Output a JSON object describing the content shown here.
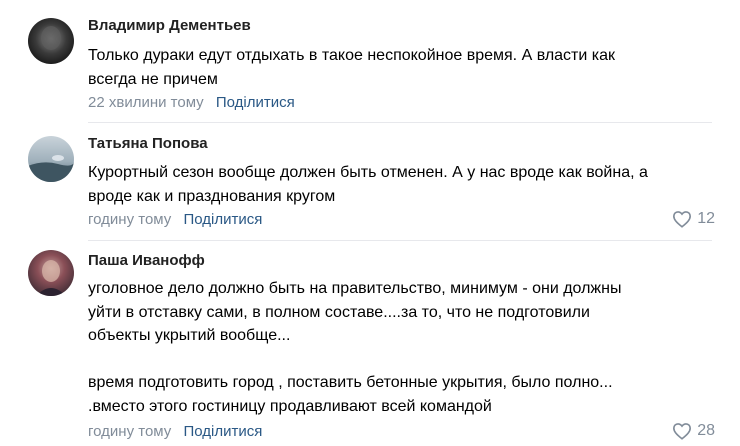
{
  "comments": [
    {
      "author": "Владимир Дементьев",
      "lines": [
        "Только дураки едут отдыхать в такое неспокойное время. А власти как",
        "всегда не причем"
      ],
      "time": "22 хвилини тому",
      "share_label": "Поділитися",
      "likes": ""
    },
    {
      "author": "Татьяна Попова",
      "lines": [
        "Курортный сезон вообще должен быть отменен. А у нас вроде как война, а",
        "вроде как и празднования кругом"
      ],
      "time": "годину тому",
      "share_label": "Поділитися",
      "likes": "12"
    },
    {
      "author": "Паша Иванофф",
      "lines": [
        "уголовное дело должно быть на правительство, минимум - они должны",
        "уйти в отставку сами, в полном составе....за то, что не подготовили",
        "объекты укрытий вообще...",
        "",
        "время подготовить город , поставить бетонные укрытия, было полно...",
        ".вместо этого гостиницу продавливают всей командой"
      ],
      "time": "годину тому",
      "share_label": "Поділитися",
      "likes": "28"
    }
  ],
  "colors": {
    "link": "#2a5885",
    "meta": "#818c99",
    "divider": "#e7e8ec"
  },
  "icons": [
    "heart-icon"
  ]
}
